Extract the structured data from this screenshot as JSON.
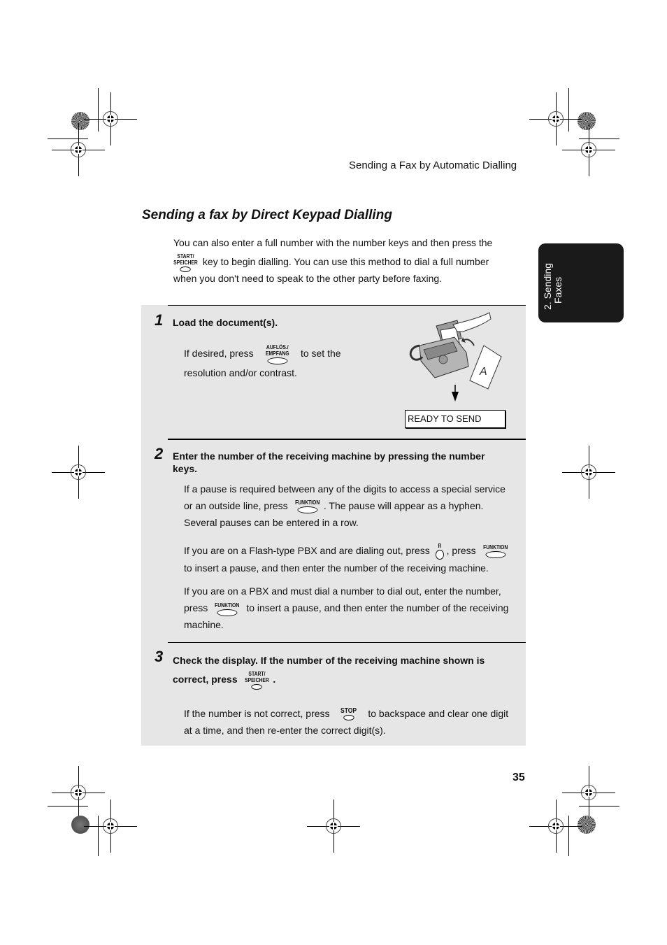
{
  "page": {
    "running_head": "Sending a Fax by Automatic Dialling",
    "page_number": "35",
    "side_tab": {
      "line1": "2. Sending",
      "line2": "Faxes"
    }
  },
  "section": {
    "title": "Sending a fax by Direct Keypad Dialling",
    "intro_line1": "You can also enter a full number with the number keys and then press the",
    "intro_line2_after_key": "key to begin dialling. You can use this method to dial a full number",
    "intro_line3": "when you don't need to speak to the other party before faxing."
  },
  "keys": {
    "start_line1": "START/",
    "start_line2": "SPEICHER",
    "aufloes_line1": "AUFLÖS./",
    "aufloes_line2": "EMPFANG",
    "funktion": "FUNKTION",
    "r": "R",
    "stop": "STOP"
  },
  "steps": [
    {
      "number": "1",
      "heading": "Load the document(s).",
      "body_before_key": "If desired, press",
      "body_after_key": "to set the",
      "body_line2": "resolution and/or contrast.",
      "display_text": "READY TO SEND"
    },
    {
      "number": "2",
      "heading_line1": "Enter the number of the receiving machine by pressing the number",
      "heading_line2": "keys.",
      "p1_line1": "If a pause is required between any of the digits to access a special service",
      "p1_line2_before": "or an outside line, press",
      "p1_line2_after": ". The pause will appear as a hyphen.",
      "p1_line3": "Several pauses can be entered in a row.",
      "p2_line1_before": "If you are on a Flash-type PBX and are dialing out, press",
      "p2_line1_mid": ", press",
      "p2_line2": "to insert a pause, and then enter the number of the receiving machine.",
      "p3_line1": "If you are on a PBX and must dial a number to dial out, enter the number,",
      "p3_line2_before": "press",
      "p3_line2_after": "to insert a pause, and then enter the number of the receiving",
      "p3_line3": "machine."
    },
    {
      "number": "3",
      "heading_line1": "Check the display. If the number of the receiving machine shown is",
      "heading_line2_before": "correct, press",
      "heading_line2_after": ".",
      "body_line1_before": "If the number is not correct, press",
      "body_line1_after": "to backspace and clear one digit",
      "body_line2": "at a time, and then re-enter the correct digit(s)."
    }
  ]
}
